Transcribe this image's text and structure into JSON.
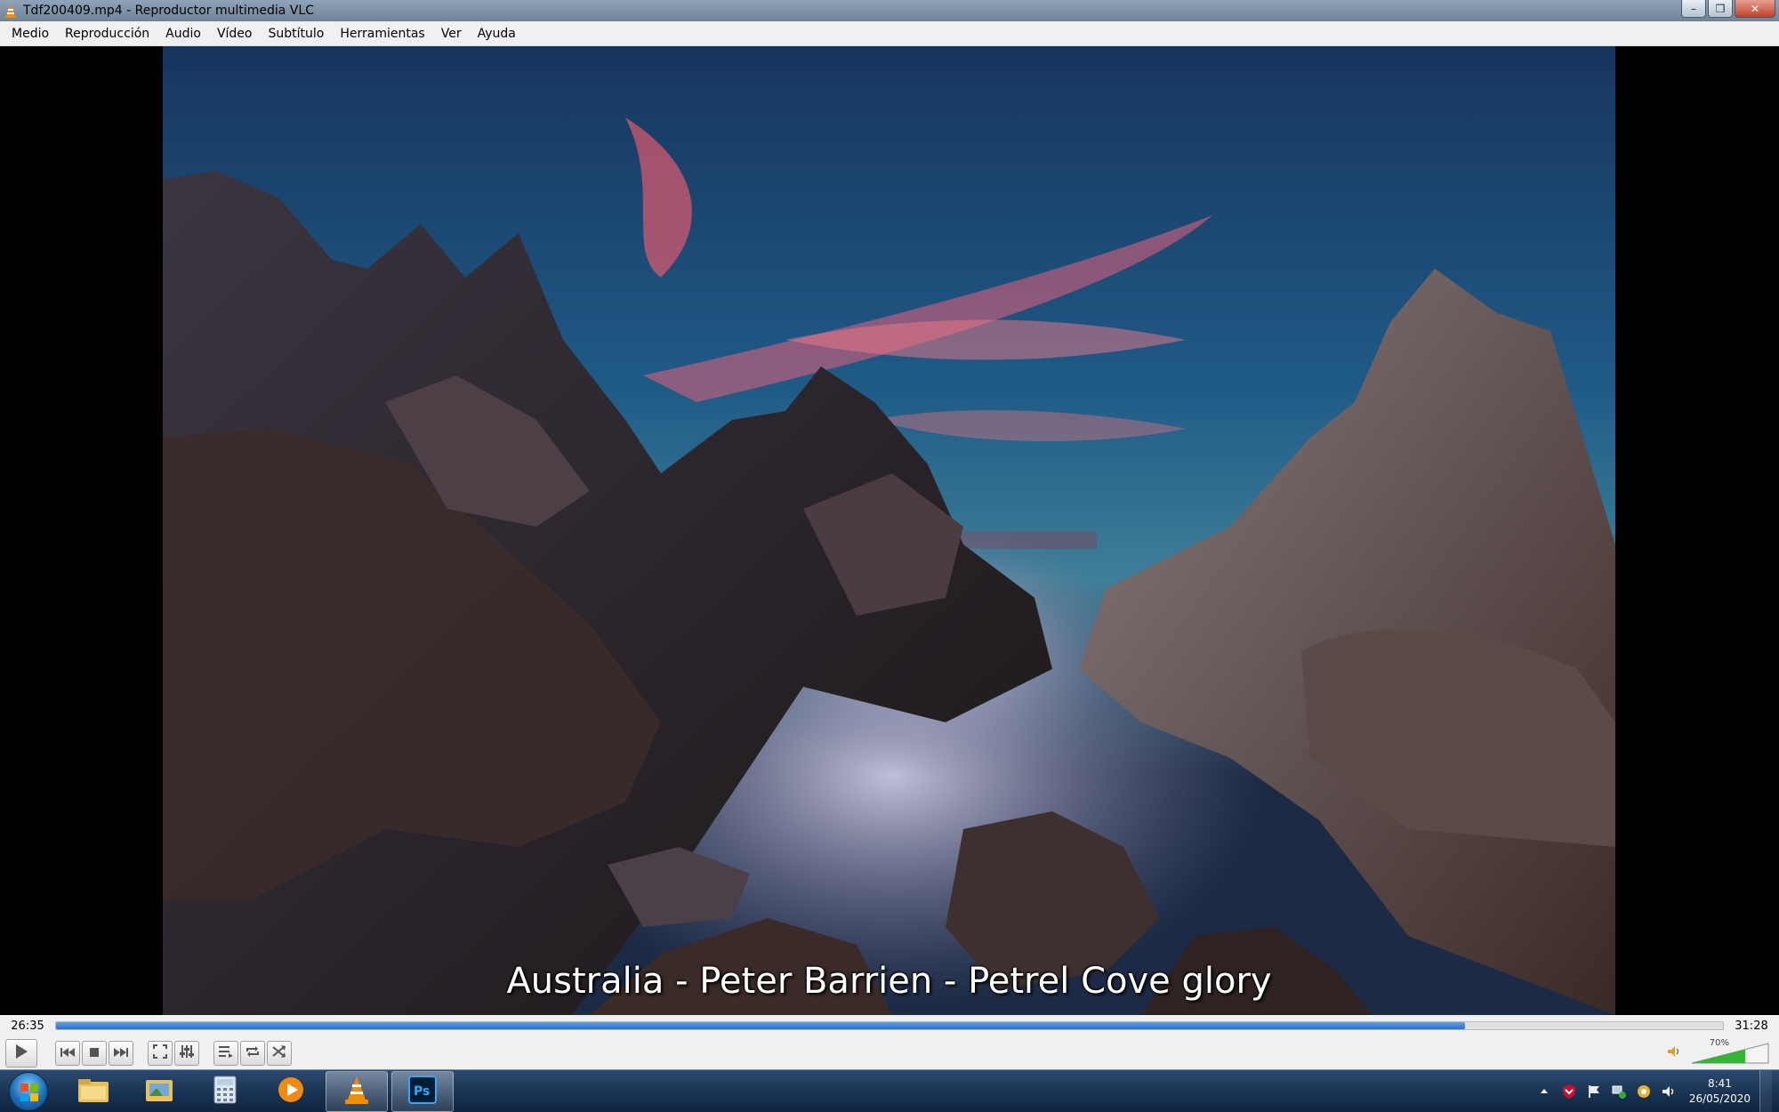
{
  "window": {
    "title": "Tdf200409.mp4 - Reproductor multimedia VLC",
    "minimize": "–",
    "maximize": "❐",
    "close": "✕"
  },
  "menu": {
    "items": [
      "Medio",
      "Reproducción",
      "Audio",
      "Vídeo",
      "Subtítulo",
      "Herramientas",
      "Ver",
      "Ayuda"
    ]
  },
  "video": {
    "subtitle": "Australia - Peter Barrien - Petrel Cove glory"
  },
  "playback": {
    "elapsed": "26:35",
    "total": "31:28",
    "progress_fraction": 0.845
  },
  "volume": {
    "percent_label": "70%",
    "level_fraction": 0.7
  },
  "taskbar": {
    "clock_time": "8:41",
    "clock_date": "26/05/2020"
  },
  "colors": {
    "seek_fill": "#2b6fc8",
    "vlc_orange": "#f28c00",
    "volume_fill": "#34b434"
  }
}
